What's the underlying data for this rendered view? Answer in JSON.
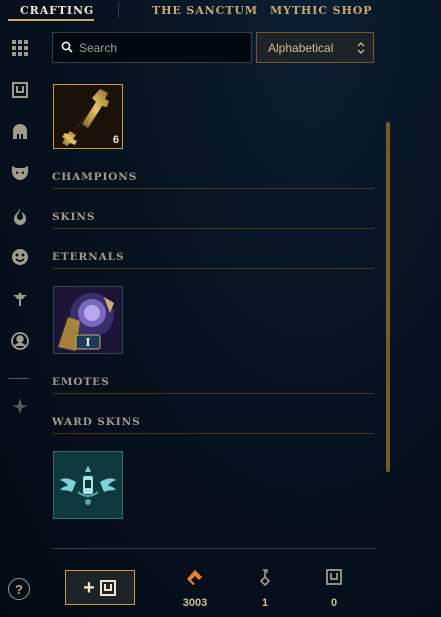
{
  "tabs": [
    {
      "label": "CRAFTING",
      "active": true
    },
    {
      "label": "THE SANCTUM",
      "active": false
    },
    {
      "label": "MYTHIC SHOP",
      "active": false
    }
  ],
  "sidebar": {
    "items": [
      {
        "icon": "grid-icon"
      },
      {
        "icon": "chest-icon"
      },
      {
        "icon": "helmet-icon"
      },
      {
        "icon": "mask-icon"
      },
      {
        "icon": "flame-icon"
      },
      {
        "icon": "emote-icon"
      },
      {
        "icon": "ward-icon"
      },
      {
        "icon": "profile-icon"
      },
      {
        "icon": "mythic-icon"
      }
    ]
  },
  "search": {
    "placeholder": "Search",
    "value": ""
  },
  "sort": {
    "selected": "Alphabetical"
  },
  "items": {
    "key_fragment_count": "6",
    "eternal_series": "I"
  },
  "sections": [
    {
      "label": "CHAMPIONS"
    },
    {
      "label": "SKINS"
    },
    {
      "label": "ETERNALS"
    },
    {
      "label": "EMOTES"
    },
    {
      "label": "WARD SKINS"
    }
  ],
  "footer": {
    "help": "?",
    "add_label": "+",
    "currencies": [
      {
        "icon": "orange-essence-icon",
        "value": "3003"
      },
      {
        "icon": "key-icon",
        "value": "1"
      },
      {
        "icon": "chest-icon",
        "value": "0"
      }
    ]
  },
  "colors": {
    "gold": "#c8aa6e",
    "accent_orange": "#f0832b",
    "background": "#050e18"
  }
}
